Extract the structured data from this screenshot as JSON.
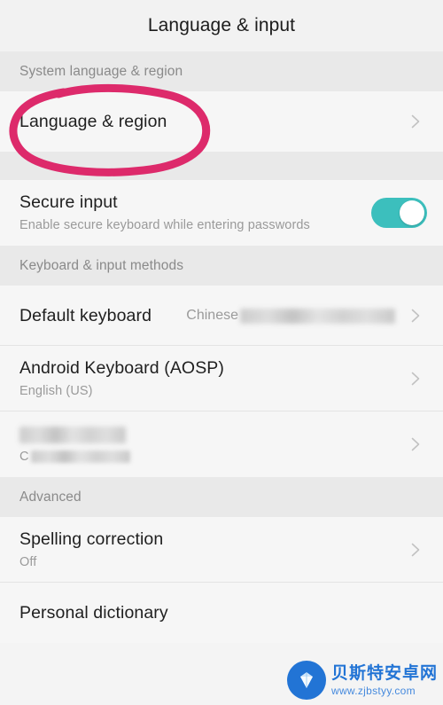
{
  "header": {
    "title": "Language & input"
  },
  "sections": [
    {
      "id": "system-language-region",
      "label": "System language & region",
      "rows": [
        {
          "id": "language-region",
          "title": "Language & region",
          "subtitle": "",
          "value": "",
          "accessory": "chevron",
          "annotated": true
        }
      ]
    },
    {
      "id": "secure-input-group",
      "label": "",
      "rows": [
        {
          "id": "secure-input",
          "title": "Secure input",
          "subtitle": "Enable secure keyboard while entering passwords",
          "value": "",
          "accessory": "toggle",
          "toggle_on": true
        }
      ]
    },
    {
      "id": "keyboard-input-methods",
      "label": "Keyboard & input methods",
      "rows": [
        {
          "id": "default-keyboard",
          "title": "Default keyboard",
          "subtitle": "",
          "value": "Chinese",
          "value_redacted": true,
          "accessory": "chevron"
        },
        {
          "id": "android-keyboard-aosp",
          "title": "Android Keyboard (AOSP)",
          "subtitle": "English (US)",
          "value": "",
          "accessory": "chevron"
        },
        {
          "id": "redacted-input-method",
          "title": "",
          "title_redacted": true,
          "subtitle": "C",
          "subtitle_redacted": true,
          "value": "",
          "accessory": "chevron"
        }
      ]
    },
    {
      "id": "advanced",
      "label": "Advanced",
      "rows": [
        {
          "id": "spelling-correction",
          "title": "Spelling correction",
          "subtitle": "Off",
          "value": "",
          "accessory": "chevron"
        },
        {
          "id": "personal-dictionary",
          "title": "Personal dictionary",
          "subtitle": "",
          "value": "",
          "accessory": "none"
        }
      ]
    }
  ],
  "annotation": {
    "shape": "hand-drawn-ellipse",
    "color": "#dd2a6b",
    "target": "Language & region"
  },
  "watermark": {
    "name": "贝斯特安卓网",
    "url": "www.zjbstyy.com",
    "color": "#1a6fd4"
  },
  "colors": {
    "toggle_on": "#3cbfbd",
    "row_background": "#f6f6f6",
    "band_background": "#e9e9e9",
    "title_background": "#f2f2f2",
    "primary_text": "#1f1f1f",
    "secondary_text": "#9a9a9a",
    "annotation_pink": "#dd2a6b"
  }
}
